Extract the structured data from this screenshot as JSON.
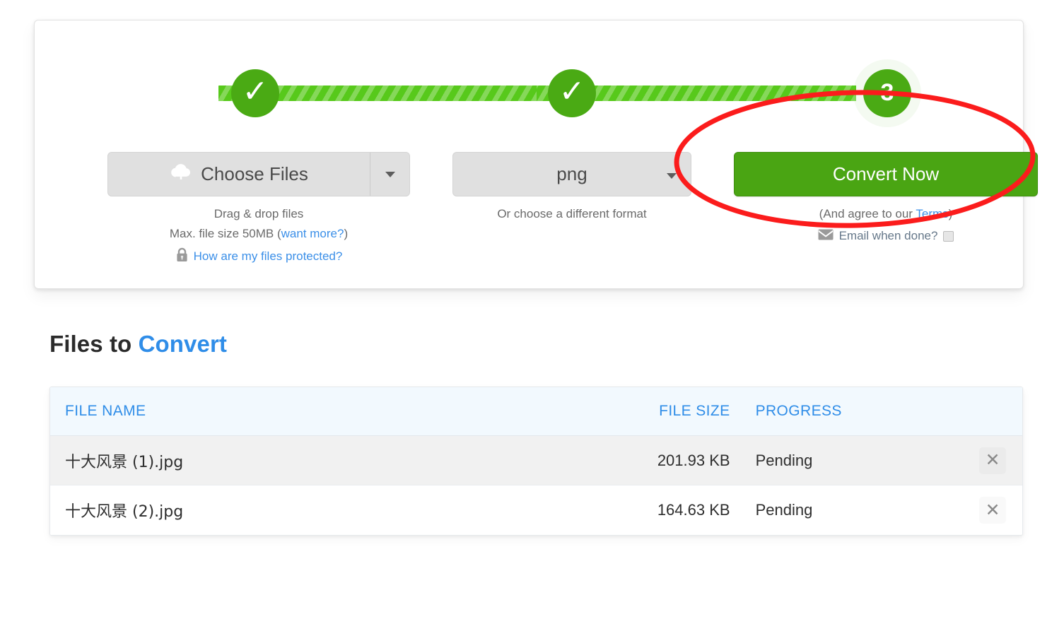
{
  "stepper": {
    "step1": {
      "state": "complete",
      "icon": "check-icon",
      "label": "✓"
    },
    "step2": {
      "state": "complete",
      "icon": "check-icon",
      "label": "✓"
    },
    "step3": {
      "state": "active",
      "label": "3"
    },
    "bar_color": "#57c91b",
    "circle_color": "#4aaa14"
  },
  "upload": {
    "button_label": "Choose Files",
    "icon": "cloud-upload-icon",
    "dropdown_icon": "chevron-down-icon",
    "hint_line1": "Drag & drop files",
    "hint_line2_prefix": "Max. file size 50MB (",
    "hint_line2_link": "want more?",
    "hint_line2_suffix": ")",
    "protected_link": "How are my files protected?",
    "protected_icon": "lock-icon"
  },
  "format": {
    "selected": "png",
    "dropdown_icon": "chevron-down-icon",
    "hint": "Or choose a different format"
  },
  "convert": {
    "button_label": "Convert Now",
    "terms_prefix": "(And agree to our ",
    "terms_link": "Terms",
    "terms_suffix": ")",
    "email_icon": "envelope-icon",
    "email_label": "Email when done?",
    "email_checked": false,
    "button_color": "#4aa513"
  },
  "annotation": {
    "shape": "ellipse",
    "color": "#fb1c1c",
    "target": "convert-now-button"
  },
  "files_section": {
    "title_plain": "Files to ",
    "title_accent": "Convert",
    "accent_color": "#2f8de8",
    "columns": [
      "FILE NAME",
      "FILE SIZE",
      "PROGRESS",
      ""
    ],
    "rows": [
      {
        "name": "十大风景 (1).jpg",
        "size": "201.93 KB",
        "progress": "Pending",
        "delete_icon": "close-icon"
      },
      {
        "name": "十大风景 (2).jpg",
        "size": "164.63 KB",
        "progress": "Pending",
        "delete_icon": "close-icon"
      }
    ]
  }
}
